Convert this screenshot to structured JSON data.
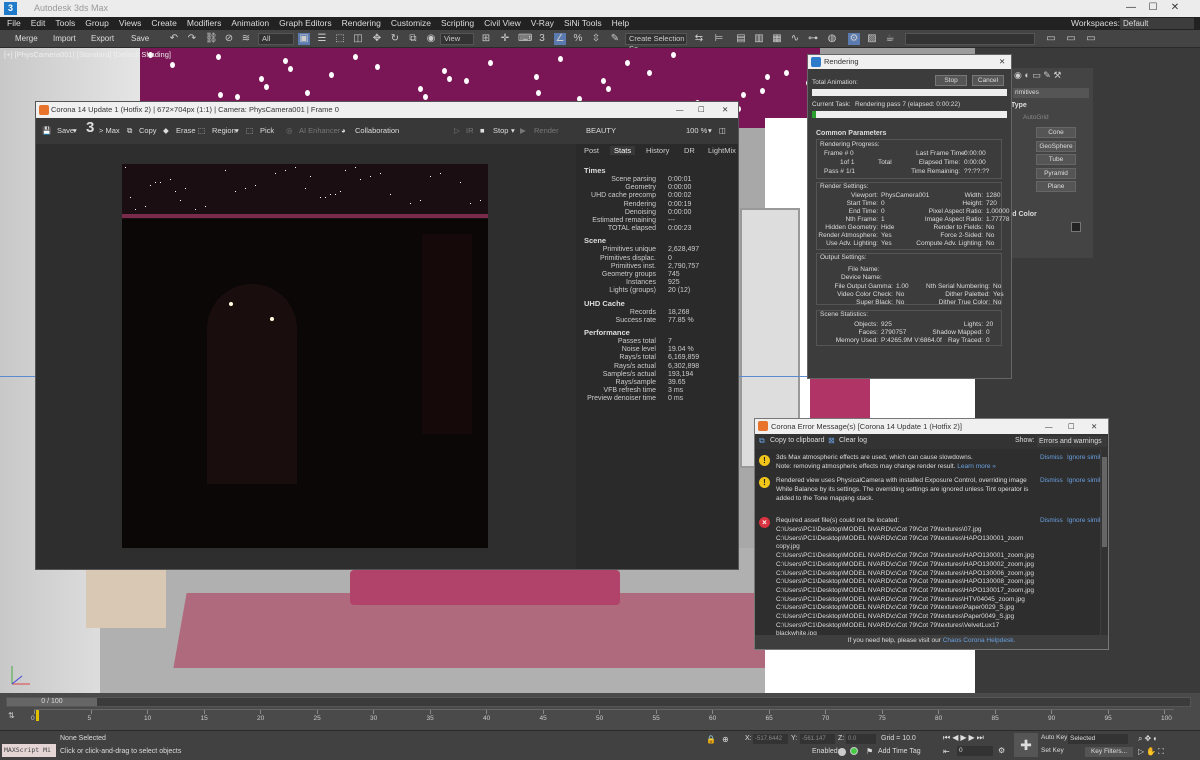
{
  "menu": [
    "File",
    "Edit",
    "Tools",
    "Group",
    "Views",
    "Create",
    "Modifiers",
    "Animation",
    "Graph Editors",
    "Rendering",
    "Customize",
    "Scripting",
    "Civil View",
    "V-Ray",
    "SiNi Tools",
    "Help"
  ],
  "workspaces": {
    "label": "Workspaces:",
    "value": "Default"
  },
  "toolbar": {
    "merge": "Merge",
    "import": "Import",
    "export": "Export",
    "save": "Save",
    "filter": "All",
    "view": "View",
    "selection_set": "Create Selection Se"
  },
  "viewport": {
    "label": "[+] [PhysCamera001] [Standard] [Default Shading]"
  },
  "vfb": {
    "title": "Corona 14 Update 1 (Hotfix 2) | 672×704px (1:1) | Camera: PhysCamera001 | Frame 0",
    "save": "Save",
    "max": "> Max",
    "copy": "Copy",
    "erase": "Erase",
    "region": "Region",
    "pick": "Pick",
    "ai": "AI Enhancer",
    "collab": "Collaboration",
    "ir": "IR",
    "stop": "Stop",
    "render": "Render",
    "beauty": "BEAUTY",
    "zoom": "100 %",
    "tabs": [
      "Post",
      "Stats",
      "History",
      "DR",
      "LightMix"
    ],
    "stats": [
      {
        "head": "Times"
      },
      {
        "k": "Scene parsing",
        "v": "0:00:01"
      },
      {
        "k": "Geometry",
        "v": "0:00:00"
      },
      {
        "k": "UHD cache precomp",
        "v": "0:00:02"
      },
      {
        "k": "Rendering",
        "v": "0:00:19"
      },
      {
        "k": "Denoising",
        "v": "0:00:00"
      },
      {
        "k": "Estimated remaining",
        "v": "---"
      },
      {
        "k": "TOTAL elapsed",
        "v": "0:00:23"
      },
      {
        "head": "Scene"
      },
      {
        "k": "Primitives unique",
        "v": "2,628,497"
      },
      {
        "k": "Primitives displac.",
        "v": "0"
      },
      {
        "k": "Primitives inst.",
        "v": "2,790,757"
      },
      {
        "k": "Geometry groups",
        "v": "745"
      },
      {
        "k": "Instances",
        "v": "925"
      },
      {
        "k": "Lights (groups)",
        "v": "20 (12)"
      },
      {
        "head": "UHD Cache"
      },
      {
        "k": "Records",
        "v": "18,268"
      },
      {
        "k": "Success rate",
        "v": "77.85 %"
      },
      {
        "head": "Performance"
      },
      {
        "k": "Passes total",
        "v": "7"
      },
      {
        "k": "Noise level",
        "v": "19.04 %"
      },
      {
        "k": "Rays/s total",
        "v": "6,169,859"
      },
      {
        "k": "Rays/s actual",
        "v": "6,302,898"
      },
      {
        "k": "Samples/s actual",
        "v": "193,194"
      },
      {
        "k": "Rays/sample",
        "v": "39.65"
      },
      {
        "k": "VFB refresh time",
        "v": "3 ms"
      },
      {
        "k": "Preview denoiser time",
        "v": "0 ms"
      }
    ]
  },
  "rendering": {
    "title": "Rendering",
    "total_animation": "Total Animation:",
    "stop": "Stop",
    "cancel": "Cancel",
    "current_task": "Current Task:",
    "task_value": "Rendering pass 7 (elapsed: 0:00:22)",
    "task_progress": 0.02,
    "common": "Common Parameters",
    "progress_title": "Rendering Progress:",
    "frame_label": "Frame #",
    "frame_val": "0",
    "of_val": "1of 1",
    "total": "Total",
    "pass_label": "Pass #",
    "pass_val": "1/1",
    "last_frame_label": "Last Frame Time:",
    "last_frame_val": "0:00:00",
    "elapsed_label": "Elapsed Time:",
    "elapsed_val": "0:00:00",
    "remaining_label": "Time Remaining:",
    "remaining_val": "??:??:??",
    "render_settings": "Render Settings:",
    "rs_left": [
      {
        "k": "Viewport:",
        "v": "PhysCamera001"
      },
      {
        "k": "Start Time:",
        "v": "0"
      },
      {
        "k": "End Time:",
        "v": "0"
      },
      {
        "k": "Nth Frame:",
        "v": "1"
      },
      {
        "k": "Hidden Geometry:",
        "v": "Hide"
      },
      {
        "k": "Render Atmosphere:",
        "v": "Yes"
      },
      {
        "k": "Use Adv. Lighting:",
        "v": "Yes"
      }
    ],
    "rs_right": [
      {
        "k": "Width:",
        "v": "1280"
      },
      {
        "k": "Height:",
        "v": "720"
      },
      {
        "k": "Pixel Aspect Ratio:",
        "v": "1.00000"
      },
      {
        "k": "Image Aspect Ratio:",
        "v": "1.77778"
      },
      {
        "k": "Render to Fields:",
        "v": "No"
      },
      {
        "k": "Force 2-Sided:",
        "v": "No"
      },
      {
        "k": "Compute Adv. Lighting:",
        "v": "No"
      }
    ],
    "output_settings": "Output Settings:",
    "os_file": "File Name:",
    "os_device": "Device Name:",
    "os_left": [
      {
        "k": "File Output Gamma:",
        "v": "1.00"
      },
      {
        "k": "Video Color Check:",
        "v": "No"
      },
      {
        "k": "Super Black:",
        "v": "No"
      }
    ],
    "os_right": [
      {
        "k": "Nth Serial Numbering:",
        "v": "No"
      },
      {
        "k": "Dither Paletted:",
        "v": "Yes"
      },
      {
        "k": "Dither True Color:",
        "v": "No"
      }
    ],
    "scene_stats": "Scene Statistics:",
    "ss_left": [
      {
        "k": "Objects:",
        "v": "925"
      },
      {
        "k": "Faces:",
        "v": "2790757"
      },
      {
        "k": "Memory Used:",
        "v": "P:4265.9M V:6864.0f"
      }
    ],
    "ss_right": [
      {
        "k": "Lights:",
        "v": "20"
      },
      {
        "k": "Shadow Mapped:",
        "v": "0"
      },
      {
        "k": "Ray Traced:",
        "v": "0"
      }
    ]
  },
  "command_panel": {
    "dropdown": "rimitives",
    "type": "Type",
    "autogrid": "AutoGrid",
    "buttons": [
      "Cone",
      "GeoSphere",
      "Tube",
      "Pyramid",
      "Plane"
    ],
    "color": "nd Color"
  },
  "error": {
    "title": "Corona Error Message(s)   [Corona 14 Update 1 (Hotfix 2)]",
    "copy": "Copy to clipboard",
    "clear": "Clear log",
    "show_label": "Show:",
    "show_value": "Errors and warnings",
    "dismiss": "Dismiss",
    "ignore": "Ignore simila",
    "msg1": [
      "3ds Max atmospheric effects are used, which can cause slowdowns.",
      "Note: removing atmospheric effects may change render result."
    ],
    "learn": "Learn more »",
    "msg2": [
      "Rendered view uses PhysicalCamera with installed Exposure Control, overriding image",
      "White Balance by its settings. The overriding settings are ignored unless Tint operator is",
      "added to the Tone mapping stack."
    ],
    "msg3_head": "Required asset file(s) could not be located:",
    "files": [
      "C:\\Users\\PC1\\Desktop\\MODEL NVARD\\c\\Cot 79\\Cot 79\\textures\\07.jpg",
      "C:\\Users\\PC1\\Desktop\\MODEL NVARD\\c\\Cot 79\\Cot 79\\textures\\HAPO130001_zoom",
      "copy.jpg",
      "C:\\Users\\PC1\\Desktop\\MODEL NVARD\\c\\Cot 79\\Cot 79\\textures\\HAPO130001_zoom.jpg",
      "C:\\Users\\PC1\\Desktop\\MODEL NVARD\\c\\Cot 79\\Cot 79\\textures\\HAPO130002_zoom.jpg",
      "C:\\Users\\PC1\\Desktop\\MODEL NVARD\\c\\Cot 79\\Cot 79\\textures\\HAPO130006_zoom.jpg",
      "C:\\Users\\PC1\\Desktop\\MODEL NVARD\\c\\Cot 79\\Cot 79\\textures\\HAPO130008_zoom.jpg",
      "C:\\Users\\PC1\\Desktop\\MODEL NVARD\\c\\Cot 79\\Cot 79\\textures\\HAPO130017_zoom.jpg",
      "C:\\Users\\PC1\\Desktop\\MODEL NVARD\\c\\Cot 79\\Cot 79\\textures\\HTV04045_zoom.jpg",
      "C:\\Users\\PC1\\Desktop\\MODEL NVARD\\c\\Cot 79\\Cot 79\\textures\\Paper0029_S.jpg",
      "C:\\Users\\PC1\\Desktop\\MODEL NVARD\\c\\Cot 79\\Cot 79\\textures\\Paper0049_S.jpg",
      "C:\\Users\\PC1\\Desktop\\MODEL NVARD\\c\\Cot 79\\Cot 79\\textures\\VelvetLux17",
      "blackwhite.jpg"
    ],
    "footer": "If you need help, please visit our",
    "helpdesk": "Chaos Corona Helpdesk."
  },
  "timeline": {
    "position": "0 / 100",
    "ticks": [
      "0",
      "5",
      "10",
      "15",
      "20",
      "25",
      "30",
      "35",
      "40",
      "45",
      "50",
      "55",
      "60",
      "65",
      "70",
      "75",
      "80",
      "85",
      "90",
      "95",
      "100"
    ]
  },
  "status": {
    "maxscript": "MAXScript Mi",
    "selection": "None Selected",
    "hint": "Click or click-and-drag to select objects",
    "x_label": "X:",
    "x_val": "-517.6442",
    "y_label": "Y:",
    "y_val": "-561.147",
    "z_label": "Z:",
    "z_val": "0.0",
    "grid": "Grid = 10.0",
    "enabled": "Enabled:",
    "add_time_tag": "Add Time Tag",
    "frame": "0",
    "auto_key": "Auto Key",
    "set_key": "Set Key",
    "selected": "Selected",
    "key_filters": "Key Filters..."
  }
}
